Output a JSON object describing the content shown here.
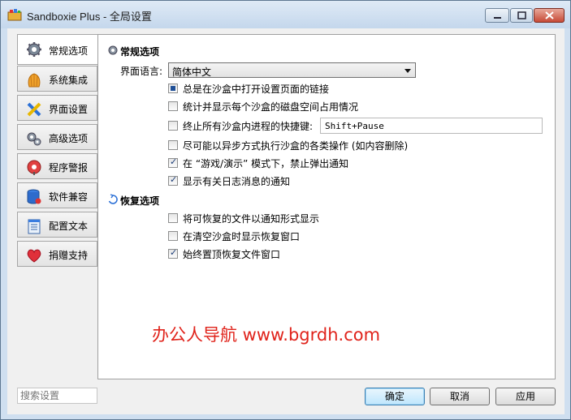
{
  "window": {
    "title": "Sandboxie Plus - 全局设置",
    "controls": {
      "minimize": "minimize-icon",
      "maximize": "maximize-icon",
      "close": "close-icon"
    }
  },
  "tabs": [
    {
      "label": "常规选项",
      "icon": "gear-icon",
      "active": true
    },
    {
      "label": "系统集成",
      "icon": "shell-icon",
      "active": false
    },
    {
      "label": "界面设置",
      "icon": "interface-icon",
      "active": false
    },
    {
      "label": "高级选项",
      "icon": "gears-icon",
      "active": false
    },
    {
      "label": "程序警报",
      "icon": "alert-icon",
      "active": false
    },
    {
      "label": "软件兼容",
      "icon": "database-icon",
      "active": false
    },
    {
      "label": "配置文本",
      "icon": "notepad-icon",
      "active": false
    },
    {
      "label": "捐赠支持",
      "icon": "heart-icon",
      "active": false
    }
  ],
  "general": {
    "heading": "常规选项",
    "language_label": "界面语言:",
    "language_value": "简体中文",
    "options": [
      {
        "label": "总是在沙盒中打开设置页面的链接",
        "state": "partial"
      },
      {
        "label": "统计并显示每个沙盒的磁盘空间占用情况",
        "state": "unchecked"
      },
      {
        "label": "终止所有沙盒内进程的快捷键:",
        "state": "unchecked"
      },
      {
        "label": "尽可能以异步方式执行沙盒的各类操作 (如内容删除)",
        "state": "unchecked"
      },
      {
        "label": "在 “游戏/演示” 模式下，禁止弹出通知",
        "state": "checked"
      },
      {
        "label": "显示有关日志消息的通知",
        "state": "checked"
      }
    ],
    "hotkey_value": "Shift+Pause"
  },
  "recovery": {
    "heading": "恢复选项",
    "options": [
      {
        "label": "将可恢复的文件以通知形式显示",
        "state": "unchecked"
      },
      {
        "label": "在清空沙盒时显示恢复窗口",
        "state": "unchecked"
      },
      {
        "label": "始终置顶恢复文件窗口",
        "state": "checked"
      }
    ]
  },
  "watermark": "办公人导航 www.bgrdh.com",
  "footer": {
    "search_placeholder": "搜索设置",
    "ok": "确定",
    "cancel": "取消",
    "apply": "应用"
  },
  "colors": {
    "accent": "#3c7fb1",
    "watermark": "#e0231b",
    "window_frame": "#cfdff0"
  }
}
